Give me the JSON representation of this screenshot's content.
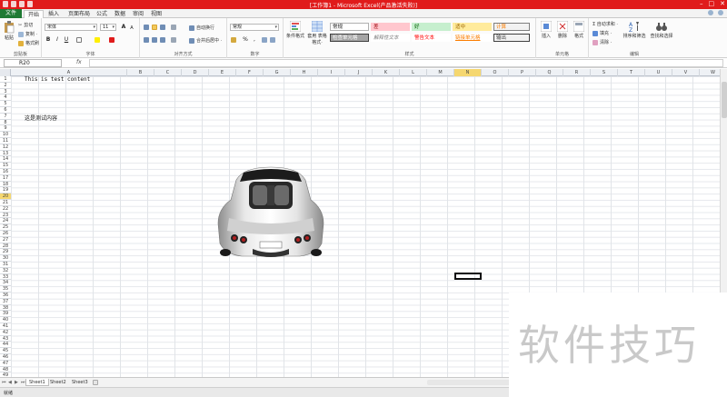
{
  "window": {
    "title": "[工作簿1 - Microsoft Excel(产品激活失败)]",
    "controls": [
      "–",
      "□",
      "✕"
    ]
  },
  "tabs": [
    "文件",
    "开始",
    "插入",
    "页面布局",
    "公式",
    "数据",
    "审阅",
    "视图"
  ],
  "ribbon": {
    "clipboard": {
      "paste": "粘贴",
      "cut": "剪切",
      "copy": "复制 ·",
      "format_painter": "格式刷",
      "label": "剪贴板"
    },
    "font": {
      "name": "宋体",
      "size": "11",
      "bold": "B",
      "italic": "I",
      "underline": "U",
      "grow": "A",
      "shrink": "A",
      "label": "字体"
    },
    "alignment": {
      "wrap": "自动换行",
      "merge": "合并后居中 ·",
      "label": "对齐方式"
    },
    "number": {
      "format": "常规",
      "percent": "%",
      "comma": ",",
      "label": "数字"
    },
    "styles": {
      "conditional": "条件格式",
      "table": "套用\n表格格式·",
      "cells": [
        {
          "text": "常规",
          "bg": "#ffffff",
          "fg": "#111111",
          "border": "#b0b0b0"
        },
        {
          "text": "差",
          "bg": "#ffc7ce",
          "fg": "#9c0006",
          "border": "#ffc7ce"
        },
        {
          "text": "好",
          "bg": "#c6efce",
          "fg": "#006100",
          "border": "#c6efce"
        },
        {
          "text": "适中",
          "bg": "#ffeb9c",
          "fg": "#9c6500",
          "border": "#ffeb9c"
        },
        {
          "text": "计算",
          "bg": "#f2f2f2",
          "fg": "#fa7d00",
          "border": "#7f7f7f"
        },
        {
          "text": "检查单元格",
          "bg": "#a5a5a5",
          "fg": "#ffffff",
          "border": "#3f3f3f"
        },
        {
          "text": "解释性文本",
          "bg": "#ffffff",
          "fg": "#7f7f7f",
          "border": "#ffffff"
        },
        {
          "text": "警告文本",
          "bg": "#ffffff",
          "fg": "#ff0000",
          "border": "#ffffff"
        },
        {
          "text": "链接单元格",
          "bg": "#ffffff",
          "fg": "#fa7d00",
          "border": "#ffffff"
        },
        {
          "text": "输出",
          "bg": "#f2f2f2",
          "fg": "#3f3f3f",
          "border": "#3f3f3f"
        }
      ],
      "label": "样式"
    },
    "cells_group": {
      "insert": "插入",
      "delete": "删除",
      "format": "格式",
      "label": "单元格"
    },
    "editing": {
      "autosum": "Σ 自动求和 ·",
      "fill": "填充 ·",
      "clear": "清除 ·",
      "sort": "排序和筛选",
      "find": "查找和选择",
      "label": "编辑"
    }
  },
  "formula_bar": {
    "name_box": "R20",
    "fx": "fx",
    "value": ""
  },
  "columns": [
    "A",
    "B",
    "C",
    "D",
    "E",
    "F",
    "G",
    "H",
    "I",
    "J",
    "K",
    "L",
    "M",
    "N",
    "O",
    "P",
    "Q",
    "R",
    "S",
    "T",
    "U",
    "V",
    "W"
  ],
  "selected_column": "N",
  "rows": [
    "1",
    "2",
    "3",
    "4",
    "5",
    "6",
    "7",
    "8",
    "9",
    "10",
    "11",
    "12",
    "13",
    "14",
    "15",
    "16",
    "17",
    "18",
    "19",
    "20",
    "21",
    "22",
    "23",
    "24",
    "25",
    "26",
    "27",
    "28",
    "29",
    "30",
    "31",
    "32",
    "33",
    "34",
    "35",
    "36",
    "37",
    "38",
    "39",
    "40",
    "41",
    "42",
    "43",
    "44",
    "45",
    "46",
    "47",
    "48",
    "49",
    "50"
  ],
  "selected_row": "20",
  "cells": [
    {
      "row": 1,
      "text": "This is test content"
    },
    {
      "row": 7,
      "text": "这是测试内容"
    }
  ],
  "sheets": [
    "Sheet1",
    "Sheet2",
    "Sheet3"
  ],
  "status": {
    "ready": "就绪"
  },
  "watermark": "软件技巧"
}
